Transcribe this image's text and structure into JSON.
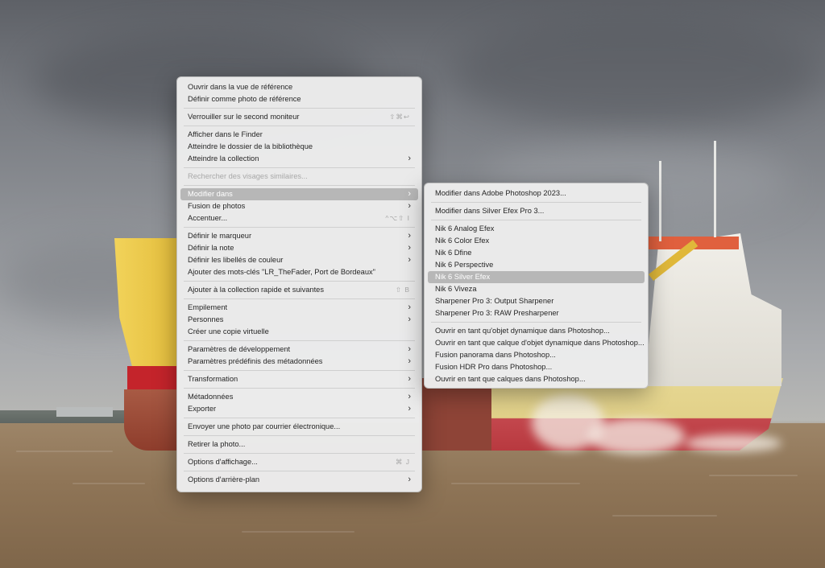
{
  "context_menu": {
    "groups": [
      [
        {
          "label": "Ouvrir dans la vue de référence"
        },
        {
          "label": "Définir comme photo de référence"
        }
      ],
      [
        {
          "label": "Verrouiller sur le second moniteur",
          "shortcut": "⇧⌘↩"
        }
      ],
      [
        {
          "label": "Afficher dans le Finder"
        },
        {
          "label": "Atteindre le dossier de la bibliothèque"
        },
        {
          "label": "Atteindre la collection",
          "submenu": true
        }
      ],
      [
        {
          "label": "Rechercher des visages similaires...",
          "disabled": true
        }
      ],
      [
        {
          "label": "Modifier dans",
          "submenu": true,
          "highlighted": true
        },
        {
          "label": "Fusion de photos",
          "submenu": true
        },
        {
          "label": "Accentuer...",
          "shortcut": "^⌥⇧ I"
        }
      ],
      [
        {
          "label": "Définir le marqueur",
          "submenu": true
        },
        {
          "label": "Définir la note",
          "submenu": true
        },
        {
          "label": "Définir les libellés de couleur",
          "submenu": true
        },
        {
          "label": "Ajouter des mots-clés \"LR_TheFader, Port de Bordeaux\""
        }
      ],
      [
        {
          "label": "Ajouter à la collection rapide et suivantes",
          "shortcut": "⇧ B"
        }
      ],
      [
        {
          "label": "Empilement",
          "submenu": true
        },
        {
          "label": "Personnes",
          "submenu": true
        },
        {
          "label": "Créer une copie virtuelle"
        }
      ],
      [
        {
          "label": "Paramètres de développement",
          "submenu": true
        },
        {
          "label": "Paramètres prédéfinis des métadonnées",
          "submenu": true
        }
      ],
      [
        {
          "label": "Transformation",
          "submenu": true
        }
      ],
      [
        {
          "label": "Métadonnées",
          "submenu": true
        },
        {
          "label": "Exporter",
          "submenu": true
        }
      ],
      [
        {
          "label": "Envoyer une photo par courrier électronique..."
        }
      ],
      [
        {
          "label": "Retirer la photo..."
        }
      ],
      [
        {
          "label": "Options d'affichage...",
          "shortcut": "⌘ J"
        }
      ],
      [
        {
          "label": "Options d'arrière-plan",
          "submenu": true
        }
      ]
    ]
  },
  "submenu": {
    "groups": [
      [
        {
          "label": "Modifier dans Adobe Photoshop 2023..."
        }
      ],
      [
        {
          "label": "Modifier dans Silver Efex Pro 3..."
        }
      ],
      [
        {
          "label": "Nik 6 Analog Efex"
        },
        {
          "label": "Nik 6 Color Efex"
        },
        {
          "label": "Nik 6 Dfine"
        },
        {
          "label": "Nik 6 Perspective"
        },
        {
          "label": "Nik 6 Silver Efex",
          "highlighted": true
        },
        {
          "label": "Nik 6 Viveza"
        },
        {
          "label": "Sharpener Pro 3: Output Sharpener"
        },
        {
          "label": "Sharpener Pro 3: RAW Presharpener"
        }
      ],
      [
        {
          "label": "Ouvrir en tant qu'objet dynamique dans Photoshop..."
        },
        {
          "label": "Ouvrir en tant que calque d'objet dynamique dans Photoshop..."
        },
        {
          "label": "Fusion panorama dans Photoshop..."
        },
        {
          "label": "Fusion HDR Pro dans Photoshop..."
        },
        {
          "label": "Ouvrir en tant que calques dans Photoshop..."
        }
      ]
    ]
  },
  "icons": {
    "submenu_arrow": "chevron-right-icon"
  },
  "colors": {
    "highlight": "#b7b7b7",
    "menu_bg": "#ececec",
    "text": "#262626",
    "disabled": "#a8a8a8"
  }
}
